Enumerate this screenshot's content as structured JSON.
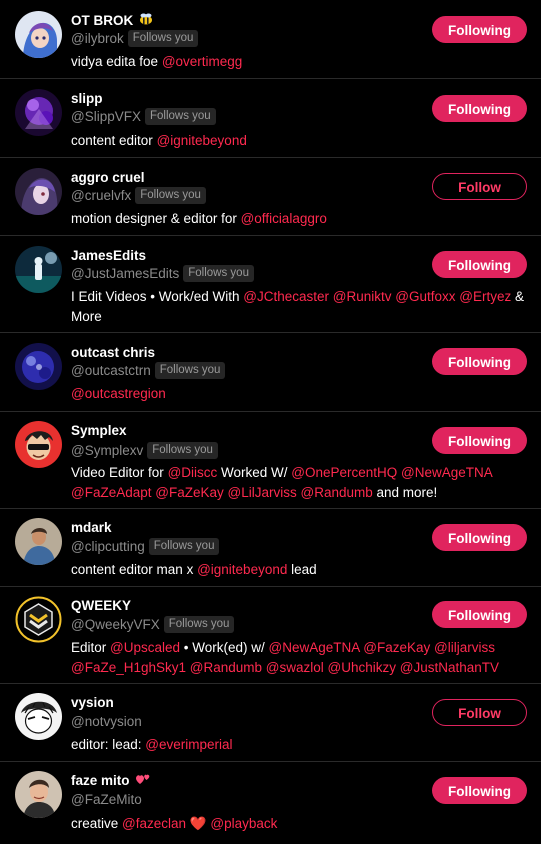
{
  "accent_color": "#e0245e",
  "mention_color": "#ff2a4f",
  "follows_you_label": "Follows you",
  "users": [
    {
      "name": "OT BROK",
      "name_emoji": "bee-emoji",
      "handle": "@ilybrok",
      "follows_you": true,
      "bio": [
        {
          "t": "vidya edita foe "
        },
        {
          "t": "@overtimegg",
          "m": true
        }
      ],
      "button": "Following"
    },
    {
      "name": "slipp",
      "handle": "@SlippVFX",
      "follows_you": true,
      "bio": [
        {
          "t": "content editor "
        },
        {
          "t": "@ignitebeyond",
          "m": true
        }
      ],
      "button": "Following"
    },
    {
      "name": "aggro cruel",
      "handle": "@cruelvfx",
      "follows_you": true,
      "bio": [
        {
          "t": "motion designer & editor for "
        },
        {
          "t": "@officialaggro",
          "m": true
        }
      ],
      "button": "Follow"
    },
    {
      "name": "JamesEdits",
      "handle": "@JustJamesEdits",
      "follows_you": true,
      "bio": [
        {
          "t": "I Edit Videos • Work/ed With "
        },
        {
          "t": "@JCthecaster",
          "m": true
        },
        {
          "t": " "
        },
        {
          "t": "@Runiktv",
          "m": true
        },
        {
          "t": " "
        },
        {
          "t": "@Gutfoxx",
          "m": true
        },
        {
          "t": " "
        },
        {
          "t": "@Ertyez",
          "m": true
        },
        {
          "t": " & More"
        }
      ],
      "button": "Following"
    },
    {
      "name": "outcast chris",
      "handle": "@outcastctrn",
      "follows_you": true,
      "bio": [
        {
          "t": "@outcastregion",
          "m": true
        }
      ],
      "button": "Following"
    },
    {
      "name": "Symplex",
      "handle": "@Symplexv",
      "follows_you": true,
      "bio": [
        {
          "t": "Video Editor for "
        },
        {
          "t": "@Diiscc",
          "m": true
        },
        {
          "t": " Worked W/ "
        },
        {
          "t": "@OnePercentHQ",
          "m": true
        },
        {
          "t": " "
        },
        {
          "t": "@NewAgeTNA",
          "m": true
        },
        {
          "t": " "
        },
        {
          "t": "@FaZeAdapt",
          "m": true
        },
        {
          "t": " "
        },
        {
          "t": "@FaZeKay",
          "m": true
        },
        {
          "t": " "
        },
        {
          "t": "@LilJarviss",
          "m": true
        },
        {
          "t": " "
        },
        {
          "t": "@Randumb",
          "m": true
        },
        {
          "t": " and more!"
        }
      ],
      "button": "Following"
    },
    {
      "name": "mdark",
      "handle": "@clipcutting",
      "follows_you": true,
      "bio": [
        {
          "t": "content editor man x "
        },
        {
          "t": "@ignitebeyond",
          "m": true
        },
        {
          "t": " lead"
        }
      ],
      "button": "Following"
    },
    {
      "name": "QWEEKY",
      "handle": "@QweekyVFX",
      "follows_you": true,
      "bio": [
        {
          "t": "Editor "
        },
        {
          "t": "@Upscaled",
          "m": true
        },
        {
          "t": " • Work(ed) w/ "
        },
        {
          "t": "@NewAgeTNA",
          "m": true
        },
        {
          "t": " "
        },
        {
          "t": "@FazeKay",
          "m": true
        },
        {
          "t": " "
        },
        {
          "t": "@liljarviss",
          "m": true
        },
        {
          "t": " "
        },
        {
          "t": "@FaZe_H1ghSky1",
          "m": true
        },
        {
          "t": " "
        },
        {
          "t": "@Randumb",
          "m": true
        },
        {
          "t": " "
        },
        {
          "t": "@swazlol",
          "m": true
        },
        {
          "t": " "
        },
        {
          "t": "@Uhchikzy",
          "m": true
        },
        {
          "t": " "
        },
        {
          "t": "@JustNathanTV",
          "m": true
        }
      ],
      "button": "Following"
    },
    {
      "name": "vysion",
      "handle": "@notvysion",
      "follows_you": false,
      "bio": [
        {
          "t": "editor: lead: "
        },
        {
          "t": "@everimperial",
          "m": true
        }
      ],
      "button": "Follow"
    },
    {
      "name": "faze mito",
      "name_emoji": "two-hearts-emoji",
      "handle": "@FaZeMito",
      "follows_you": false,
      "bio": [
        {
          "t": "creative "
        },
        {
          "t": "@fazeclan",
          "m": true
        },
        {
          "t": " "
        },
        {
          "t": "❤️",
          "e": "red-heart-emoji"
        },
        {
          "t": " "
        },
        {
          "t": "@playback",
          "m": true
        }
      ],
      "button": "Following"
    }
  ]
}
